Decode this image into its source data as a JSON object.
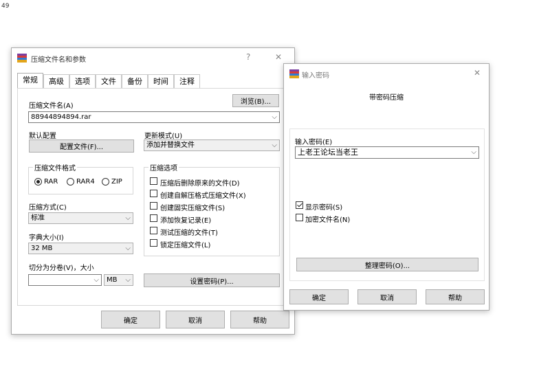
{
  "corner_number": "49",
  "archive_dialog": {
    "title": "压缩文件名和参数",
    "help_glyph": "?",
    "close_glyph": "✕",
    "tabs": [
      "常规",
      "高级",
      "选项",
      "文件",
      "备份",
      "时间",
      "注释"
    ],
    "archive_name_label": "压缩文件名(A)",
    "browse_button": "浏览(B)...",
    "archive_name_value": "88944894894.rar",
    "default_profile_label": "默认配置",
    "profiles_button": "配置文件(F)...",
    "update_mode_label": "更新模式(U)",
    "update_mode_value": "添加并替换文件",
    "format_group_title": "压缩文件格式",
    "formats": [
      "RAR",
      "RAR4",
      "ZIP"
    ],
    "options_group_title": "压缩选项",
    "options": [
      "压缩后删除原来的文件(D)",
      "创建自解压格式压缩文件(X)",
      "创建固实压缩文件(S)",
      "添加恢复记录(E)",
      "测试压缩的文件(T)",
      "锁定压缩文件(L)"
    ],
    "method_label": "压缩方式(C)",
    "method_value": "标准",
    "dict_label": "字典大小(I)",
    "dict_value": "32 MB",
    "split_label": "切分为分卷(V)，大小",
    "split_value": "",
    "split_unit": "MB",
    "set_password_button": "设置密码(P)...",
    "ok_button": "确定",
    "cancel_button": "取消",
    "help_button": "帮助"
  },
  "password_dialog": {
    "title": "输入密码",
    "close_glyph": "✕",
    "heading": "带密码压缩",
    "password_label": "输入密码(E)",
    "password_value": "上老王论坛当老王",
    "show_password": "显示密码(S)",
    "encrypt_names": "加密文件名(N)",
    "organize_button": "整理密码(O)...",
    "ok_button": "确定",
    "cancel_button": "取消",
    "help_button": "帮助"
  }
}
